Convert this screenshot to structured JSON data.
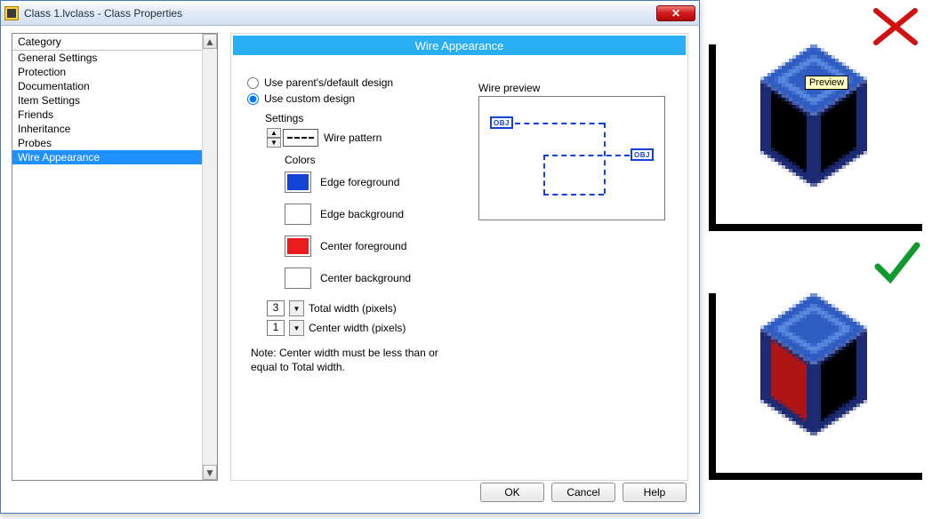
{
  "titlebar": {
    "title": "Class 1.lvclass - Class Properties"
  },
  "category": {
    "header": "Category",
    "items": [
      "General Settings",
      "Protection",
      "Documentation",
      "Item Settings",
      "Friends",
      "Inheritance",
      "Probes",
      "Wire Appearance"
    ],
    "selected": 7
  },
  "panel": {
    "title": "Wire Appearance",
    "radio_parent": "Use parent's/default design",
    "radio_custom": "Use custom design",
    "radio_selected": "custom",
    "settings_label": "Settings",
    "wire_pattern_label": "Wire pattern",
    "colors_label": "Colors",
    "swatches": [
      {
        "label": "Edge foreground",
        "color": "#1343d6"
      },
      {
        "label": "Edge background",
        "color": "#ffffff"
      },
      {
        "label": "Center foreground",
        "color": "#ed1c1c"
      },
      {
        "label": "Center background",
        "color": "#ffffff"
      }
    ],
    "total_width": {
      "value": "3",
      "label": "Total width (pixels)"
    },
    "center_width": {
      "value": "1",
      "label": "Center width (pixels)"
    },
    "note": "Note:  Center width must be less than or equal to Total width.",
    "preview_label": "Wire preview",
    "obj_tag": "OBJ"
  },
  "buttons": {
    "ok": "OK",
    "cancel": "Cancel",
    "help": "Help"
  },
  "rightside": {
    "tooltip": "Preview",
    "cube_top_center": "#000000",
    "cube_bot_center": "#b01515"
  }
}
